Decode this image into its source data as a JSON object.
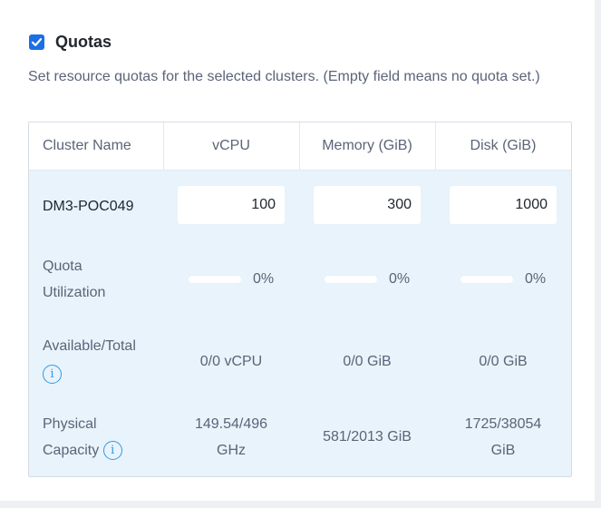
{
  "section": {
    "checked": true,
    "title": "Quotas",
    "description": "Set resource quotas for the selected clusters. (Empty field means no quota set.)"
  },
  "table": {
    "headers": [
      "Cluster Name",
      "vCPU",
      "Memory (GiB)",
      "Disk (GiB)"
    ],
    "cluster_name": "DM3-POC049",
    "quota_inputs": [
      "100",
      "300",
      "1000"
    ],
    "utilization_label_line1": "Quota",
    "utilization_label_line2": "Utilization",
    "utilization": [
      {
        "value": 0,
        "text": "0%"
      },
      {
        "value": 0,
        "text": "0%"
      },
      {
        "value": 0,
        "text": "0%"
      }
    ],
    "available_label": "Available/Total",
    "available": [
      "0/0 vCPU",
      "0/0 GiB",
      "0/0 GiB"
    ],
    "physical_label_line1": "Physical",
    "physical_label_line2": "Capacity",
    "physical": {
      "vcpu_line1": "149.54/496",
      "vcpu_line2": "GHz",
      "memory": "581/2013 GiB",
      "disk_line1": "1725/38054",
      "disk_line2": "GiB"
    }
  },
  "colors": {
    "accent": "#1b6fe4",
    "info": "#2e9ae8",
    "table_body_bg": "#e8f3fb"
  }
}
